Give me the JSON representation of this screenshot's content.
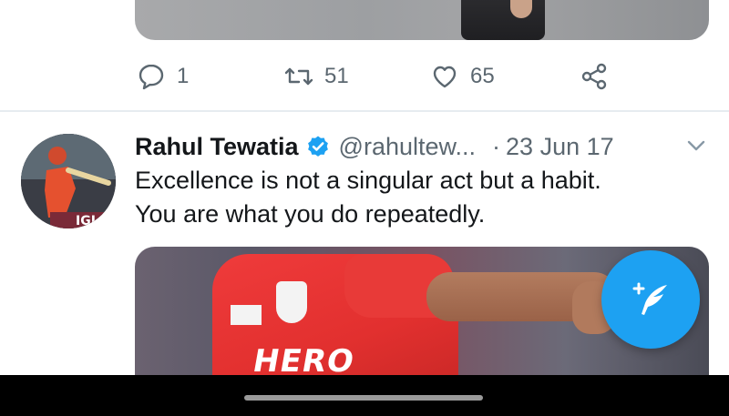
{
  "previous_tweet": {
    "actions": {
      "reply_count": "1",
      "retweet_count": "51",
      "like_count": "65"
    }
  },
  "tweet": {
    "author_name": "Rahul Tewatia",
    "handle": "@rahultew...",
    "separator": "·",
    "date": "23 Jun 17",
    "text_lines": [
      "Excellence is not a singular act but a habit.",
      "You are what you do repeatedly."
    ],
    "media_text": "HERO",
    "verified": true
  },
  "colors": {
    "brand_blue": "#1da1f2",
    "secondary_text": "#5b6770",
    "primary_text": "#14171a",
    "divider": "#e6ecf0"
  },
  "icons": [
    "reply-icon",
    "retweet-icon",
    "like-icon",
    "share-icon",
    "verified-icon",
    "chevron-down-icon",
    "compose-tweet-icon"
  ]
}
